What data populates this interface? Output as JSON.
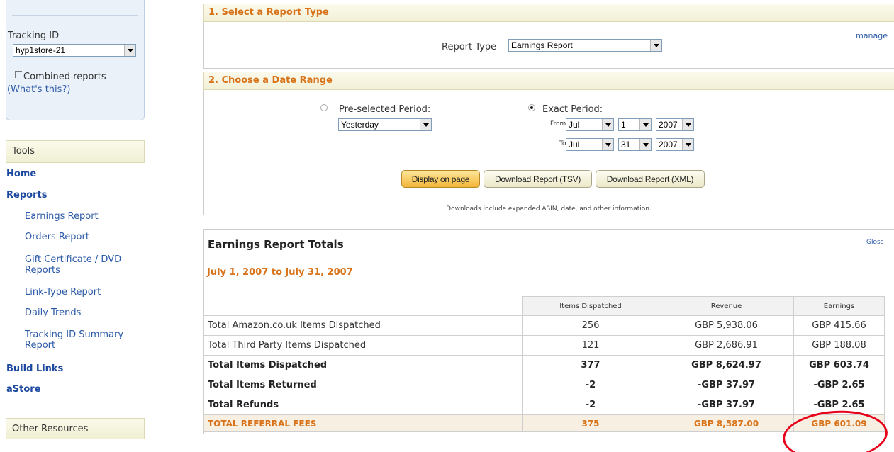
{
  "sidebar": {
    "tracking_label": "Tracking ID",
    "manage_link": "manage",
    "tracking_select_value": "hyp1store-21",
    "combined_label": "Combined reports",
    "whats_this_link": "(What's this?)",
    "tools_header": "Tools",
    "home": "Home",
    "reports": "Reports",
    "report_items": [
      "Earnings Report",
      "Orders Report",
      "Gift Certificate / DVD Reports",
      "Link-Type Report",
      "Daily Trends",
      "Tracking ID Summary Report"
    ],
    "build_links": "Build Links",
    "astore": "aStore",
    "other_resources_header": "Other Resources"
  },
  "report_type": {
    "section_title": "1. Select a Report Type",
    "label": "Report Type",
    "selected": "Earnings Report"
  },
  "date_range": {
    "section_title": "2. Choose a Date Range",
    "preselected_label": "Pre-selected Period:",
    "preselected_value": "Yesterday",
    "exact_label": "Exact Period:",
    "from_label": "From",
    "to_label": "To",
    "from": {
      "month": "Jul",
      "day": "1",
      "year": "2007"
    },
    "to": {
      "month": "Jul",
      "day": "31",
      "year": "2007"
    }
  },
  "actions": {
    "display": "Display on page",
    "download_tsv": "Download Report (TSV)",
    "download_xml": "Download Report (XML)",
    "note": "Downloads include expanded ASIN, date, and other information."
  },
  "totals": {
    "title": "Earnings Report Totals",
    "glossary_link": "Gloss",
    "date_range": "July 1, 2007 to July 31, 2007",
    "columns": [
      "Items Dispatched",
      "Revenue",
      "Earnings"
    ],
    "rows": [
      {
        "name": "Total Amazon.co.uk Items Dispatched",
        "items": "256",
        "revenue": "GBP 5,938.06",
        "earnings": "GBP 415.66"
      },
      {
        "name": "Total Third Party Items Dispatched",
        "items": "121",
        "revenue": "GBP 2,686.91",
        "earnings": "GBP 188.08"
      },
      {
        "name": "Total Items Dispatched",
        "items": "377",
        "revenue": "GBP 8,624.97",
        "earnings": "GBP 603.74"
      },
      {
        "name": "Total Items Returned",
        "items": "-2",
        "revenue": "-GBP 37.97",
        "earnings": "-GBP 2.65"
      },
      {
        "name": "Total Refunds",
        "items": "-2",
        "revenue": "-GBP 37.97",
        "earnings": "-GBP 2.65"
      },
      {
        "name": "TOTAL REFERRAL FEES",
        "items": "375",
        "revenue": "GBP 8,587.00",
        "earnings": "GBP 601.09"
      }
    ]
  },
  "colors": {
    "accent_orange": "#d8731a",
    "link_blue": "#2b5aa8",
    "annotation_red": "#e8001a"
  }
}
